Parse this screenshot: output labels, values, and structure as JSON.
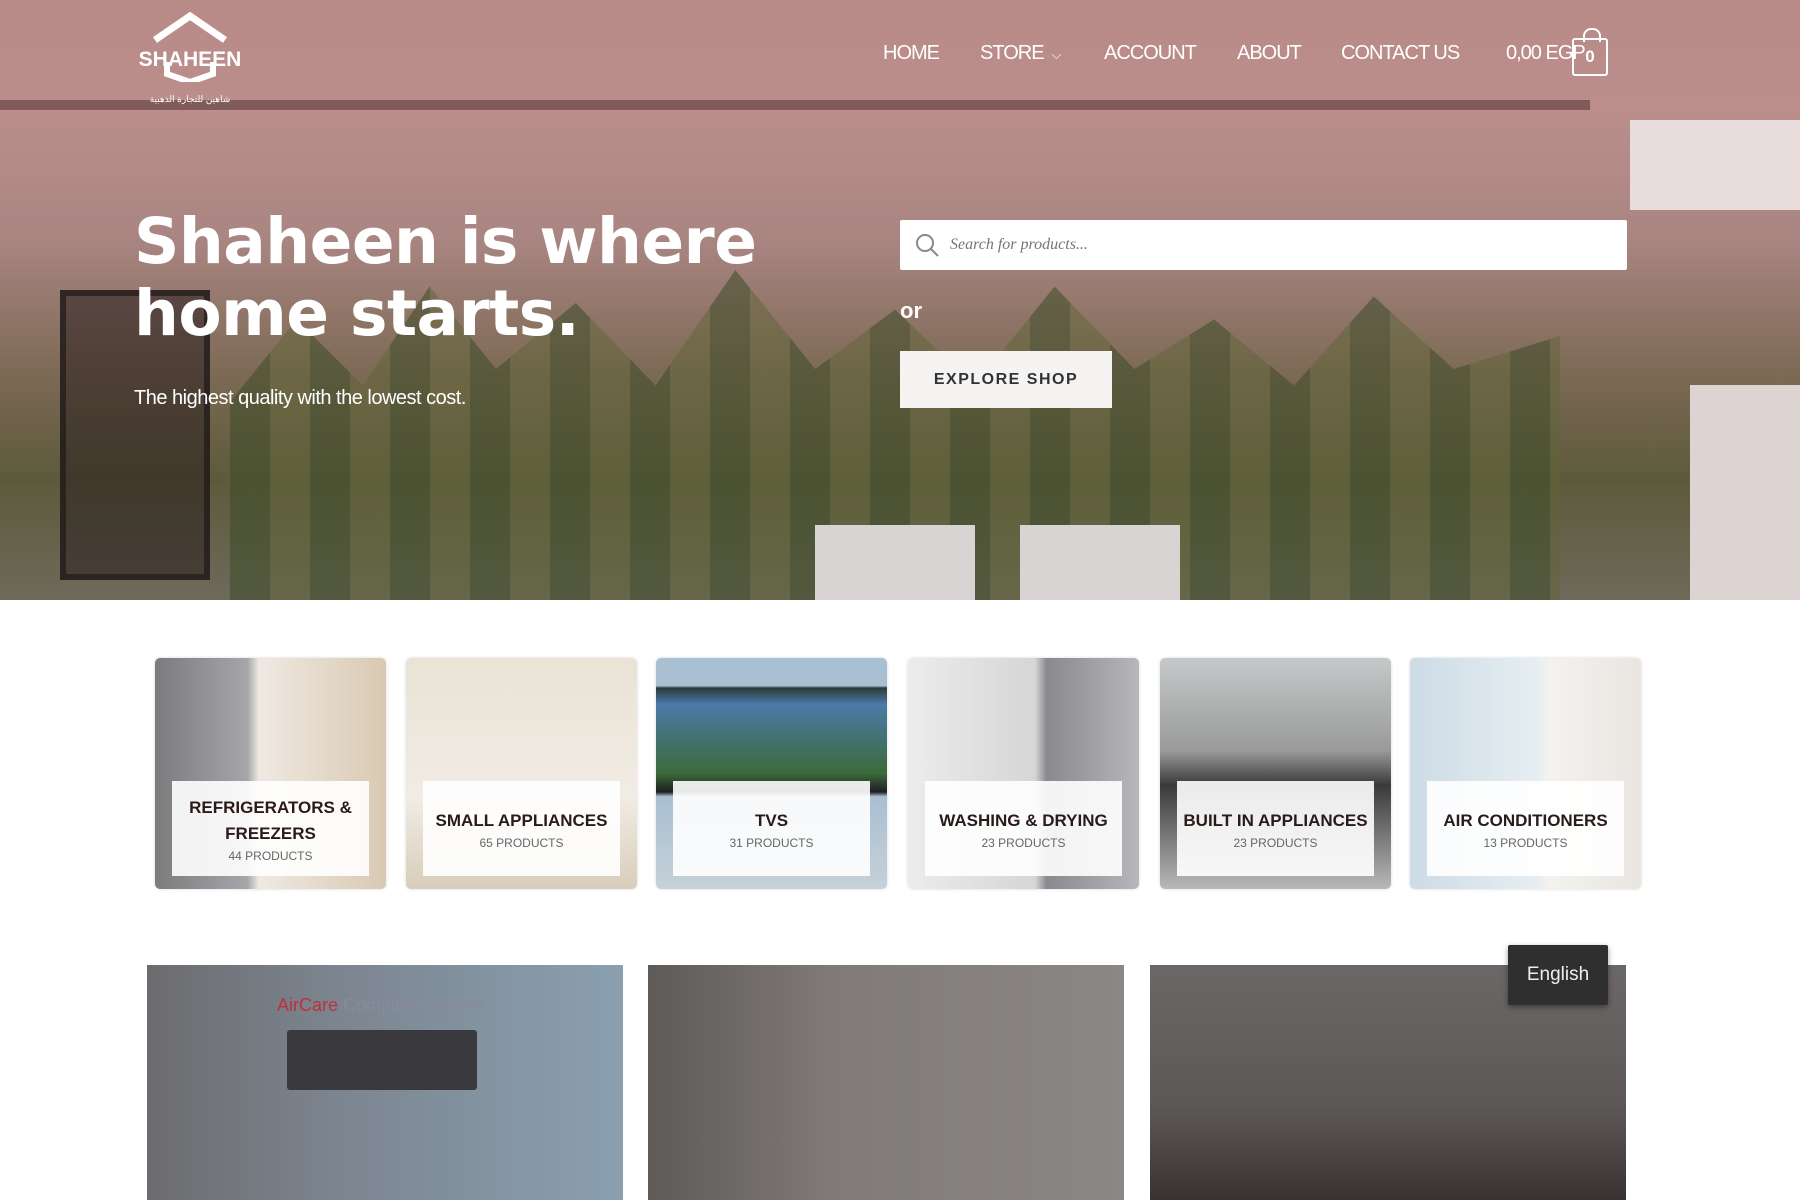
{
  "header": {
    "logo_text": "SHAHEEN",
    "logo_arabic": "شاهين للتجارة الذهبية",
    "nav": [
      {
        "label": "HOME"
      },
      {
        "label": "STORE"
      },
      {
        "label": "ACCOUNT"
      },
      {
        "label": "ABOUT"
      },
      {
        "label": "CONTACT US"
      }
    ],
    "cart_total": "0,00 EGP",
    "cart_count": "0"
  },
  "hero": {
    "headline_line1": "Shaheen is where",
    "headline_line2": "home starts.",
    "subtitle": "The highest quality with the lowest cost.",
    "search_placeholder": "Search for products...",
    "or": "or",
    "explore_label": "EXPLORE SHOP"
  },
  "categories": [
    {
      "title": "REFRIGERATORS & FREEZERS",
      "count": "44 PRODUCTS"
    },
    {
      "title": "SMALL APPLIANCES",
      "count": "65 PRODUCTS"
    },
    {
      "title": "TVS",
      "count": "31 PRODUCTS"
    },
    {
      "title": "WASHING & DRYING",
      "count": "23 PRODUCTS"
    },
    {
      "title": "BUILT IN APPLIANCES",
      "count": "23 PRODUCTS"
    },
    {
      "title": "AIR CONDITIONERS",
      "count": "13 PRODUCTS"
    }
  ],
  "banners": {
    "aircare_brand": "AirCare",
    "aircare_rest": " Complete System"
  },
  "language_button": "English",
  "colors": {
    "hero_tint": "#b88a88",
    "accent_dark": "#2a1a1a"
  }
}
